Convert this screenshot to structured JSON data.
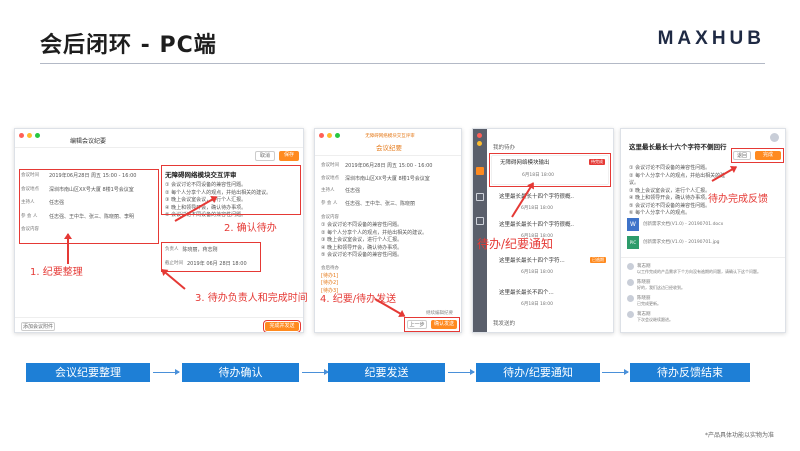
{
  "header": {
    "title": "会后闭环 - PC端",
    "brand": "MAXHUB"
  },
  "panel1": {
    "window_title": "编辑会议纪要",
    "rows": [
      {
        "label": "会议时间",
        "value": "2019年06月28日 周五 15:00 - 16:00"
      },
      {
        "label": "会议地点",
        "value": "深圳市南山区XX号大厦 8楼1号会议室"
      },
      {
        "label": "主持人",
        "value": "任志强"
      },
      {
        "label": "参 会 人",
        "value": "任志强、王中华、张三、陈晓丽、李明"
      },
      {
        "label": "会议内容",
        "value": ""
      }
    ],
    "doc_title": "无障碍网络模块交互评审",
    "doc_lines": [
      "① 会议讨论不同设备的兼容性问题。",
      "② 每个人分享个人的观点，并给出相关的建议。",
      "③ 晚上会议室会议，进行个人汇报。",
      "④ 晚上和领导开会，确认待办事项。",
      "⑤ 会议讨论不同设备的兼容性问题。"
    ],
    "assignee_label": "负责人",
    "assignee": "陈晓丽，蒋志刚",
    "due_label": "截止时间",
    "due": "2019年 06月 28日 18:00",
    "btn_cancel": "取消",
    "btn_ok": "保存",
    "btn_bottom": "完成并发送",
    "link_bottom": "添加会议附件"
  },
  "panel2": {
    "window_title": "无障碍网络模块交互评审",
    "subtitle": "会议纪要",
    "rows": [
      {
        "label": "会议时间",
        "value": "2019年06月28日 周五 15:00 - 16:00"
      },
      {
        "label": "会议地点",
        "value": "深圳市南山区XX号大厦 8楼1号会议室"
      },
      {
        "label": "主持人",
        "value": "任志强"
      },
      {
        "label": "参 会 人",
        "value": "任志强、王中华、张三、陈晓丽"
      }
    ],
    "content_label": "会议内容",
    "todo_label": "会后待办",
    "todo_tags": [
      "[待办1]",
      "[待办2]",
      "[待办3]"
    ],
    "btn_prev": "上一步",
    "btn_send": "确认发送",
    "link_edit": "继续编辑纪要"
  },
  "panel3": {
    "section_mine": "我的待办",
    "items": [
      {
        "title": "无障碍网络模块输出",
        "badge": "待完成",
        "meta": "6月18日 18:00"
      },
      {
        "title": "这里最长最长十四个字符很概..",
        "badge": "",
        "meta": "6月18日 18:00"
      },
      {
        "title": "这里最长最长十四个字符很概..",
        "badge": "",
        "meta": "6月18日 18:00"
      },
      {
        "title": "这里最长最长十四个字符...",
        "badge": "已逾期",
        "meta": "6月18日 18:00"
      },
      {
        "title": "这里最长最长不四个...",
        "badge": "",
        "meta": "6月18日 18:00"
      }
    ],
    "section_sent": "我发送的"
  },
  "panel4": {
    "title": "这里最长最长十六个字符不侧回行",
    "btn_a": "退回",
    "btn_b": "完成",
    "doc_lines": [
      "① 会议讨论不同设备的兼容性问题。",
      "② 每个人分享个人的观点，并给出相关的建议。",
      "③ 晚上会议室会议，进行个人汇报。",
      "④ 晚上和领导开会，确认待办事项。",
      "⑤ 会议讨论不同设备的兼容性问题。",
      "⑥ 每个人分享个人的观点。"
    ],
    "files": [
      {
        "icon": "W",
        "name": "创新需求文档(V1.0) - 20190701.docx"
      },
      {
        "icon": "PIC",
        "name": "创新需求文档(V1.0) - 20190701.jpg"
      }
    ],
    "comments": [
      {
        "name": "蒋志刚",
        "text": "以工作完成的产品需求下个方向没有逾期的问题，请确认下这个问题。"
      },
      {
        "name": "陈晓丽",
        "text": "好的，我们这边已经收到。"
      },
      {
        "name": "陈晓丽",
        "text": "已完成更新。"
      },
      {
        "name": "蒋志刚",
        "text": "下次会议继续跟进。"
      }
    ]
  },
  "annotations": {
    "a1": "1. 纪要整理",
    "a2": "2. 确认待办",
    "a3": "3. 待办负责人和完成时间",
    "a4": "4. 纪要/待办发送",
    "a5": "待办/纪要通知",
    "a6": "待办完成反馈"
  },
  "flow": [
    "会议纪要整理",
    "待办确认",
    "纪要发送",
    "待办/纪要通知",
    "待办反馈结束"
  ],
  "footnote": "*产品具体功能以实物为准",
  "colors": {
    "accent": "#ff8a1f",
    "annotation": "#e53935",
    "flow": "#1e7fd6"
  }
}
